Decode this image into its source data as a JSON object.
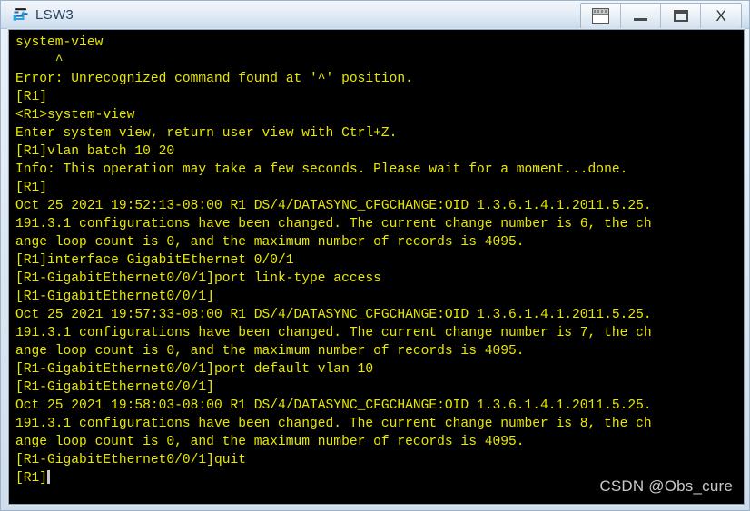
{
  "window": {
    "title": "LSW3",
    "icon": "switch-icon",
    "controls": [
      {
        "name": "restore-down-button",
        "glyph": "restore-multi-icon",
        "label": ""
      },
      {
        "name": "minimize-button",
        "glyph": "minimize-icon",
        "label": ""
      },
      {
        "name": "maximize-button",
        "glyph": "maximize-icon",
        "label": ""
      },
      {
        "name": "close-button",
        "glyph": "close-icon",
        "label": "X"
      }
    ]
  },
  "terminal": {
    "foreground_color": "#e8e800",
    "background_color": "#000000",
    "cursor_color": "#c8c8c8",
    "prompt": "[R1]",
    "lines": [
      "system-view",
      "     ^",
      "Error: Unrecognized command found at '^' position.",
      "[R1]",
      "<R1>system-view",
      "Enter system view, return user view with Ctrl+Z.",
      "[R1]vlan batch 10 20",
      "Info: This operation may take a few seconds. Please wait for a moment...done.",
      "[R1]",
      "Oct 25 2021 19:52:13-08:00 R1 DS/4/DATASYNC_CFGCHANGE:OID 1.3.6.1.4.1.2011.5.25.",
      "191.3.1 configurations have been changed. The current change number is 6, the ch",
      "ange loop count is 0, and the maximum number of records is 4095.",
      "[R1]interface GigabitEthernet 0/0/1",
      "[R1-GigabitEthernet0/0/1]port link-type access",
      "[R1-GigabitEthernet0/0/1]",
      "Oct 25 2021 19:57:33-08:00 R1 DS/4/DATASYNC_CFGCHANGE:OID 1.3.6.1.4.1.2011.5.25.",
      "191.3.1 configurations have been changed. The current change number is 7, the ch",
      "ange loop count is 0, and the maximum number of records is 4095.",
      "[R1-GigabitEthernet0/0/1]port default vlan 10",
      "[R1-GigabitEthernet0/0/1]",
      "Oct 25 2021 19:58:03-08:00 R1 DS/4/DATASYNC_CFGCHANGE:OID 1.3.6.1.4.1.2011.5.25.",
      "191.3.1 configurations have been changed. The current change number is 8, the ch",
      "ange loop count is 0, and the maximum number of records is 4095.",
      "[R1-GigabitEthernet0/0/1]quit",
      "[R1]"
    ],
    "cursor_line_index": 24
  },
  "watermark": {
    "text": "CSDN @Obs_cure"
  }
}
